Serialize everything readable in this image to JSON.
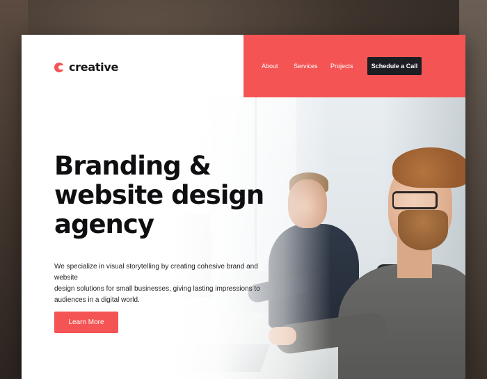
{
  "brand": {
    "name": "creative",
    "accent_color": "#f45454"
  },
  "nav": {
    "links": [
      {
        "label": "About"
      },
      {
        "label": "Services"
      },
      {
        "label": "Projects"
      }
    ],
    "cta_label": "Schedule a Call"
  },
  "hero": {
    "headline_lines": [
      "Branding &",
      "website design",
      "agency"
    ],
    "subtext_lines": [
      "We specialize in visual storytelling by creating cohesive brand and website",
      "design solutions for small businesses, giving lasting impressions to",
      "audiences in a digital world."
    ],
    "button_label": "Learn More"
  },
  "icons": {
    "logo": "brand-logo-icon"
  }
}
